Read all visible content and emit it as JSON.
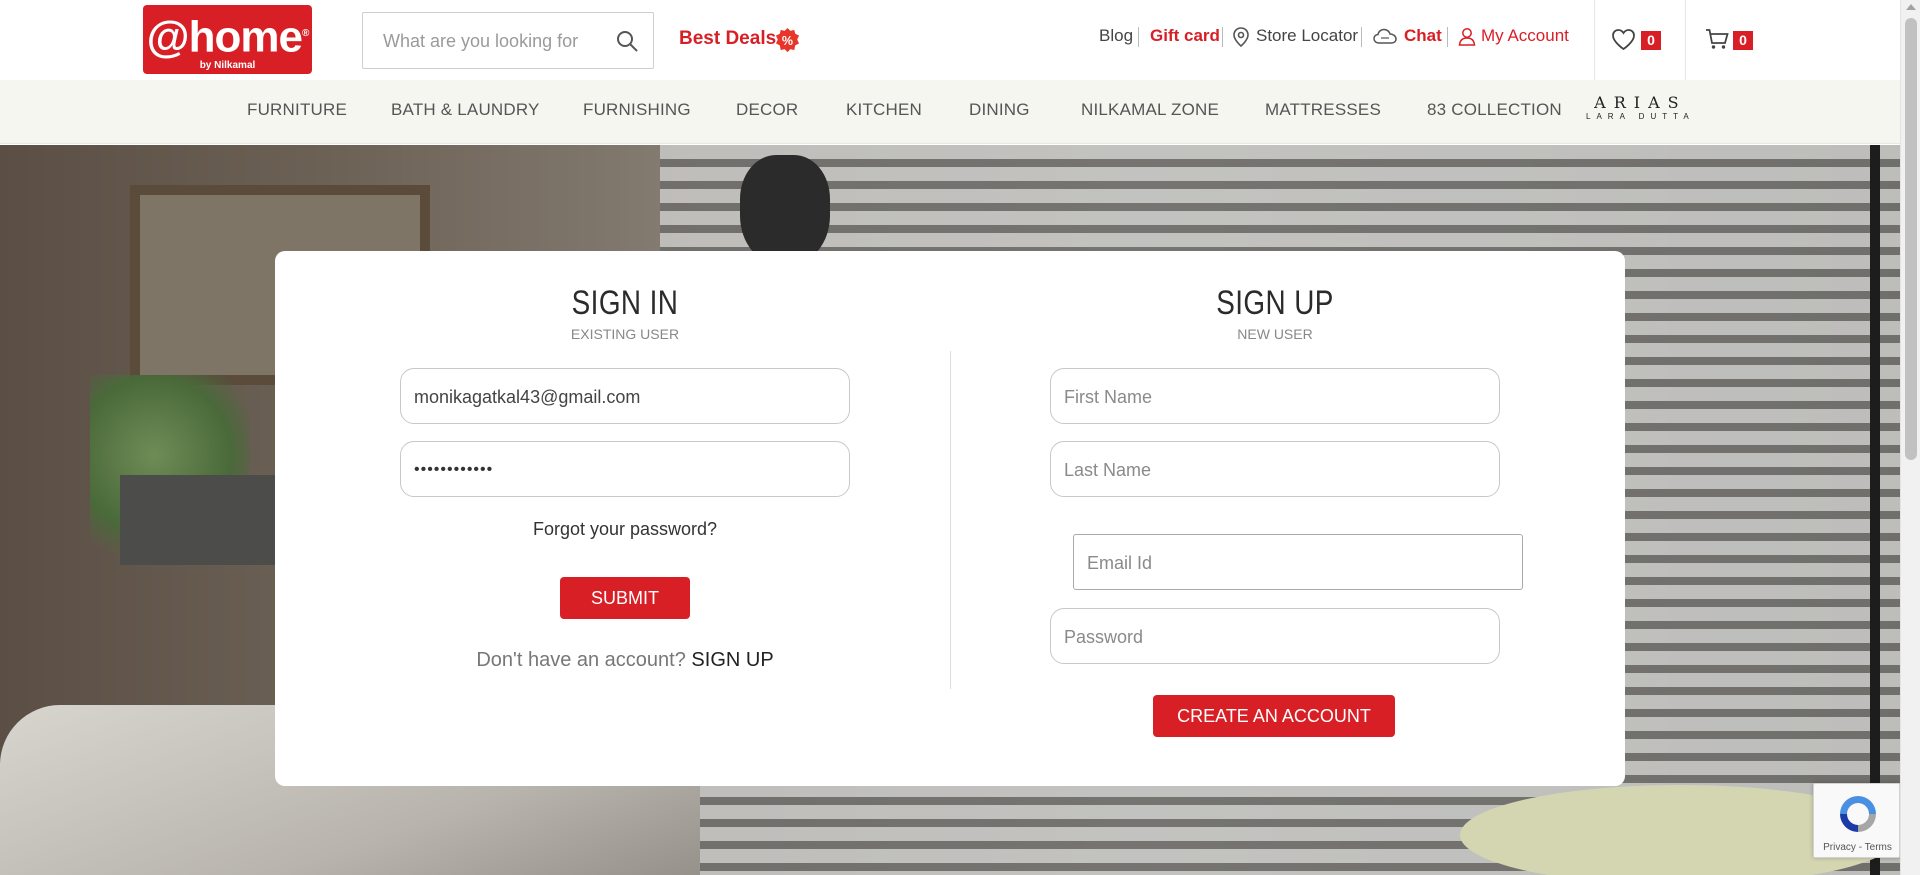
{
  "header": {
    "logo_text": "@home",
    "logo_sub": "by Nilkamal",
    "search_placeholder": "What are you looking for",
    "best_deals": "Best Deals",
    "best_deals_badge": "%",
    "links": {
      "blog": "Blog",
      "gift_card": "Gift card",
      "store_locator": "Store Locator",
      "chat": "Chat",
      "my_account": "My Account"
    },
    "wishlist_count": "0",
    "cart_count": "0"
  },
  "nav": {
    "items": [
      "FURNITURE",
      "BATH & LAUNDRY",
      "FURNISHING",
      "DECOR",
      "KITCHEN",
      "DINING",
      "NILKAMAL ZONE",
      "MATTRESSES",
      "83 COLLECTION"
    ],
    "arias_logo": "ARIAS",
    "arias_sub": "LARA DUTTA"
  },
  "signin": {
    "title": "SIGN IN",
    "subtitle": "EXISTING USER",
    "email_value": "monikagatkal43@gmail.com",
    "password_value": "••••••••••••",
    "forgot": "Forgot your password?",
    "submit": "SUBMIT",
    "no_account": "Don't have an account?",
    "signup_link": "SIGN UP"
  },
  "signup": {
    "title": "SIGN UP",
    "subtitle": "NEW USER",
    "first_name_placeholder": "First Name",
    "last_name_placeholder": "Last Name",
    "email_placeholder": "Email Id",
    "password_placeholder": "Password",
    "create_button": "CREATE AN ACCOUNT"
  },
  "recaptcha": {
    "terms": "Privacy - Terms"
  },
  "colors": {
    "brand_red": "#d81f26",
    "nav_bg": "#f6f6f1"
  }
}
